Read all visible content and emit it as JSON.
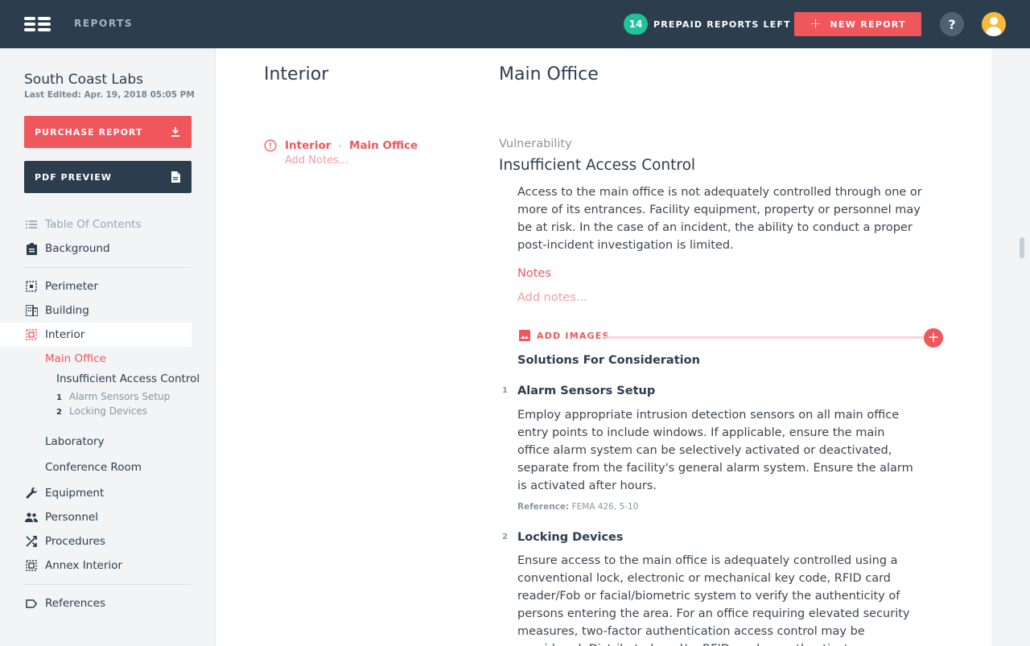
{
  "topbar": {
    "nav_label": "REPORTS",
    "prepaid_count": "14",
    "prepaid_label": "PREPAID REPORTS LEFT",
    "new_report_label": "NEW REPORT",
    "help_label": "?"
  },
  "sidebar": {
    "project_title": "South Coast Labs",
    "last_edited": "Last Edited: Apr. 19, 2018 05:05 PM",
    "purchase_label": "PURCHASE REPORT",
    "pdf_label": "PDF PREVIEW",
    "items": {
      "toc": "Table Of Contents",
      "background": "Background",
      "perimeter": "Perimeter",
      "building": "Building",
      "interior": "Interior",
      "main_office": "Main Office",
      "vulnerability": "Insufficient Access Control",
      "solution_1_num": "1",
      "solution_1": "Alarm Sensors Setup",
      "solution_2_num": "2",
      "solution_2": "Locking Devices",
      "laboratory": "Laboratory",
      "conference_room": "Conference Room",
      "equipment": "Equipment",
      "personnel": "Personnel",
      "procedures": "Procedures",
      "annex_interior": "Annex Interior",
      "references": "References"
    }
  },
  "main": {
    "section_heading": "Interior",
    "area_heading": "Main Office",
    "breadcrumb": {
      "section": "Interior",
      "area": "Main Office",
      "sep": "›"
    },
    "breadcrumb_notes": "Add Notes...",
    "vulnerability_label": "Vulnerability",
    "vulnerability_title": "Insufficient Access Control",
    "vulnerability_desc": "Access to the main office is not adequately controlled through one or more of its entrances. Facility equipment, property or personnel may be at risk. In the case of an incident, the ability to conduct a proper post-incident investigation is limited.",
    "notes_label": "Notes",
    "notes_placeholder": "Add notes...",
    "add_images_label": "ADD IMAGES",
    "solutions_heading": "Solutions For Consideration",
    "solutions": [
      {
        "num": "1",
        "title": "Alarm Sensors Setup",
        "desc": "Employ appropriate intrusion detection sensors on all main office entry points to include windows. If applicable, ensure the main office alarm system can be selectively activated or deactivated, separate from the facility's general alarm system. Ensure the alarm is activated after hours.",
        "ref_label": "Reference:",
        "ref_value": "FEMA 426, 5-10"
      },
      {
        "num": "2",
        "title": "Locking Devices",
        "desc": "Ensure access to the main office is adequately controlled using a conventional lock, electronic or mechanical key code, RFID card reader/Fob or facial/biometric system to verify the authenticity of persons entering the area. For an office requiring elevated security measures, two-factor authentication access control may be considered. Distributed card/or RFID readers authenticate"
      }
    ]
  },
  "colors": {
    "accent": "#f0575d",
    "navy": "#2c3d4e",
    "teal": "#1fc39a",
    "avatar": "#f6b93b"
  }
}
